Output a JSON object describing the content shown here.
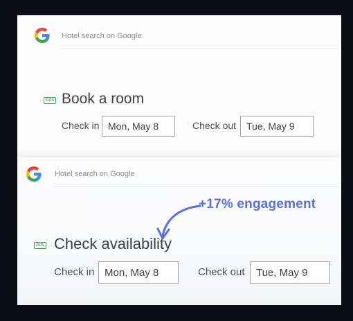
{
  "variant_a": {
    "search_label": "Hotel search on Google",
    "ads_badge": "Ads",
    "headline": "Book a room",
    "checkin_label": "Check in",
    "checkin_value": "Mon, May 8",
    "checkout_label": "Check out",
    "checkout_value": "Tue, May 9"
  },
  "variant_b": {
    "search_label": "Hotel search on Google",
    "ads_badge": "Ads",
    "headline": "Check availability",
    "checkin_label": "Check in",
    "checkin_value": "Mon, May 8",
    "checkout_label": "Check out",
    "checkout_value": "Tue, May 9"
  },
  "callout": {
    "text": "+17% engagement",
    "color": "#5a72d8"
  },
  "colors": {
    "google_blue": "#4285F4",
    "google_red": "#EA4335",
    "google_yellow": "#FBBC05",
    "google_green": "#34A853",
    "ads_green": "#3fa45b"
  },
  "icons": {
    "logo": "google-g-icon",
    "arrow": "curved-arrow-icon"
  }
}
